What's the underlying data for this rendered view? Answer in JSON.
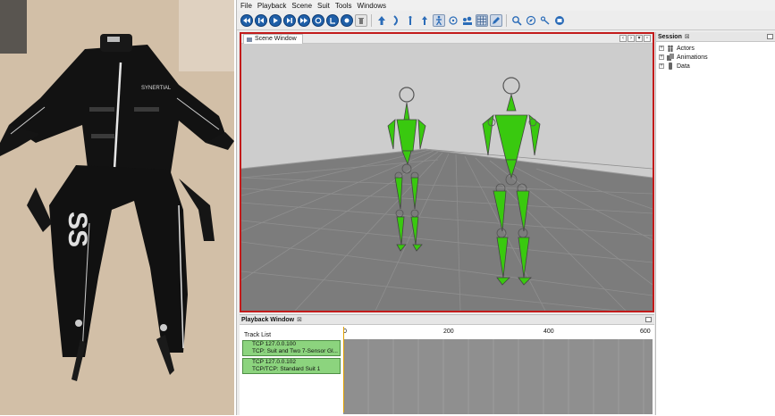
{
  "photo": {
    "jacket_logo": "SYNERTIAL",
    "pants_logo": "SS"
  },
  "menubar": [
    "File",
    "Playback",
    "Scene",
    "Suit",
    "Tools",
    "Windows"
  ],
  "toolbar": {
    "icons": [
      "rewind-icon",
      "step-back-icon",
      "play-icon",
      "step-forward-icon",
      "fast-forward-icon",
      "loop-icon",
      "record-icon",
      "stop-icon",
      "delete-icon",
      "arrow-up-icon",
      "arrow-curve-icon",
      "figure-icon",
      "figure-up-icon",
      "skeleton-icon",
      "target-icon",
      "group-icon",
      "grid-icon",
      "pen-icon",
      "search-icon",
      "compass-icon",
      "link-icon",
      "print-icon"
    ],
    "selected": [
      "skeleton-icon",
      "grid-icon",
      "pen-icon"
    ]
  },
  "scene_window": {
    "tab_title": "Scene Window",
    "background_color": "#cfcfcf",
    "floor_color": "#7a7a7a",
    "skeleton_color": "#39c90f"
  },
  "session": {
    "title": "Session",
    "close_glyph": "⊠",
    "items": [
      {
        "label": "Actors",
        "icon": "actors-icon"
      },
      {
        "label": "Animations",
        "icon": "animations-icon"
      },
      {
        "label": "Data",
        "icon": "data-icon"
      }
    ]
  },
  "playback": {
    "title": "Playback Window",
    "close_glyph": "⊠",
    "tracklist_label": "Track List",
    "ruler_ticks": [
      "0",
      "200",
      "400",
      "600"
    ],
    "tracks": [
      {
        "line1": "TCP 127.0.0.100",
        "line2": "TCP: Suit and Two 7-Sensor Gl..."
      },
      {
        "line1": "TCP 127.0.0.102",
        "line2": "TCP/TCP: Standard Suit 1"
      }
    ]
  }
}
